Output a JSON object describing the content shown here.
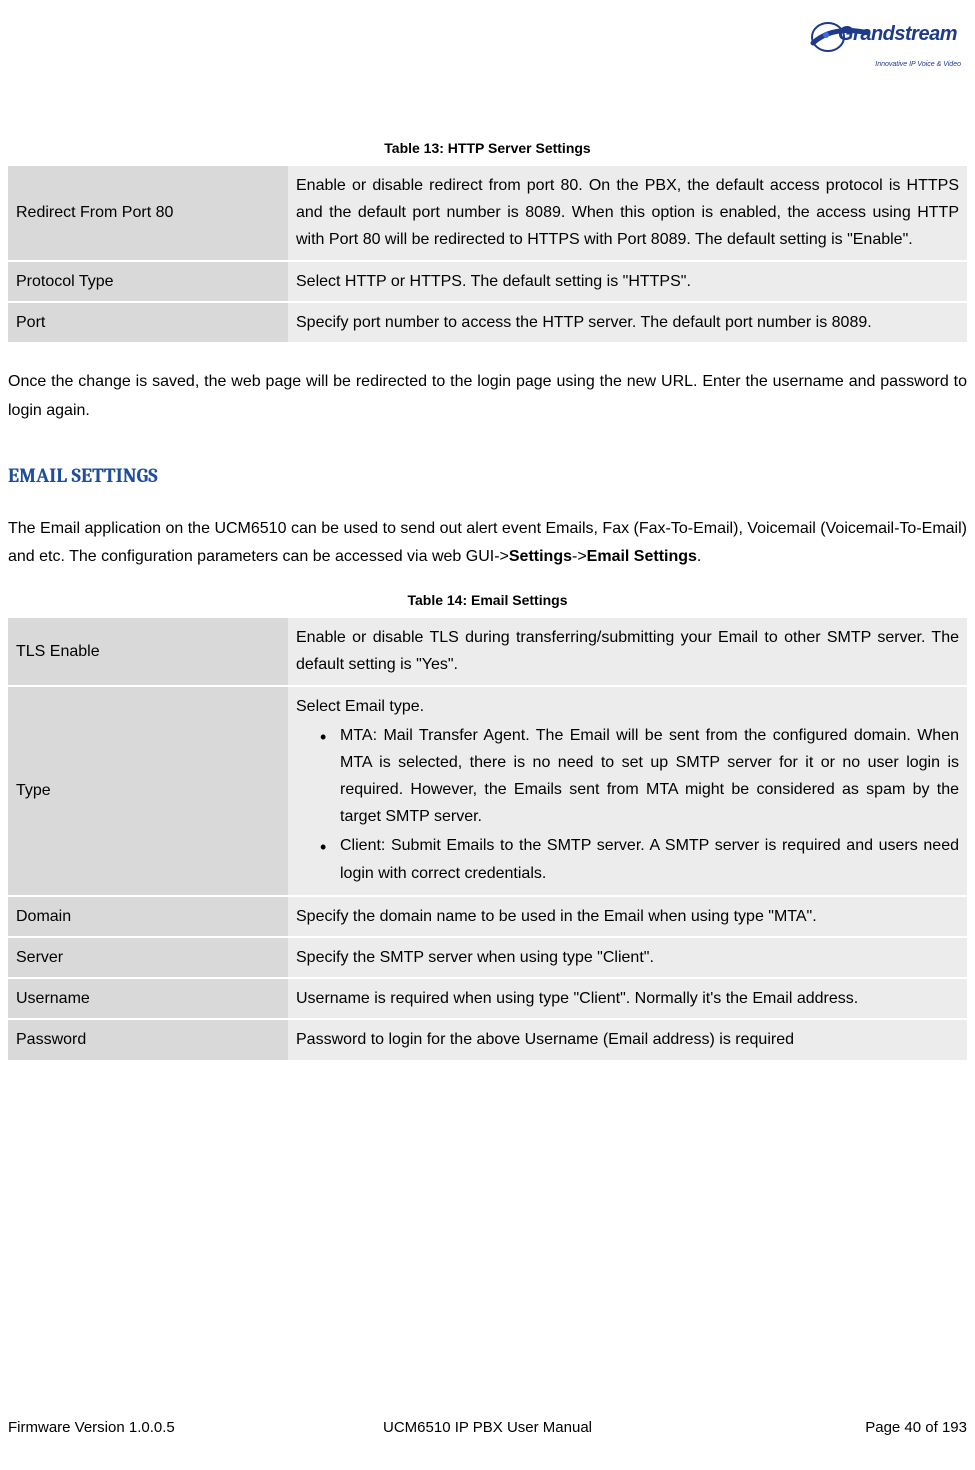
{
  "logo": {
    "brand": "Grandstream",
    "tagline": "Innovative IP Voice & Video"
  },
  "table13": {
    "caption": "Table 13: HTTP Server Settings",
    "rows": [
      {
        "label": "Redirect From Port 80",
        "desc": "Enable or disable redirect from port 80. On the PBX, the default access protocol is HTTPS and the default port number is 8089. When this option is enabled, the access using HTTP with Port 80 will be redirected to HTTPS with Port 8089. The default setting is \"Enable\"."
      },
      {
        "label": "Protocol Type",
        "desc": "Select HTTP or HTTPS. The default setting is \"HTTPS\"."
      },
      {
        "label": "Port",
        "desc": "Specify port number to access the HTTP server. The default port number is 8089."
      }
    ]
  },
  "para1": "Once the change is saved, the web page will be redirected to the login page using the new URL. Enter the username and password to login again.",
  "heading": "EMAIL SETTINGS",
  "intro": {
    "text1": "The Email application on the UCM6510 can be used to send out alert event Emails, Fax (Fax-To-Email), Voicemail (Voicemail-To-Email) and etc. The configuration parameters can be accessed via web GUI->",
    "bold1": "Settings",
    "text2": "->",
    "bold2": "Email Settings",
    "text3": "."
  },
  "table14": {
    "caption": "Table 14: Email Settings",
    "rows": {
      "tls": {
        "label": "TLS Enable",
        "desc": "Enable or disable TLS during transferring/submitting your Email to other SMTP server. The default setting is \"Yes\"."
      },
      "type": {
        "label": "Type",
        "intro": "Select Email type.",
        "bullet1": "MTA: Mail Transfer Agent. The Email will be sent from the configured domain. When MTA is selected, there is no need to set up SMTP server for it or no user login is required. However, the Emails sent from MTA might be considered as spam by the target SMTP server.",
        "bullet2": "Client: Submit Emails to the SMTP server. A SMTP server is required and users need login with correct credentials."
      },
      "domain": {
        "label": "Domain",
        "desc": "Specify the domain name to be used in the Email when using type \"MTA\"."
      },
      "server": {
        "label": "Server",
        "desc": "Specify the SMTP server when using type \"Client\"."
      },
      "username": {
        "label": "Username",
        "desc": "Username is required when using type \"Client\". Normally it's the Email address."
      },
      "password": {
        "label": "Password",
        "desc": "Password to login for the above Username (Email address) is required"
      }
    }
  },
  "footer": {
    "left": "Firmware Version 1.0.0.5",
    "center": "UCM6510 IP PBX User Manual",
    "right": "Page 40 of 193"
  }
}
